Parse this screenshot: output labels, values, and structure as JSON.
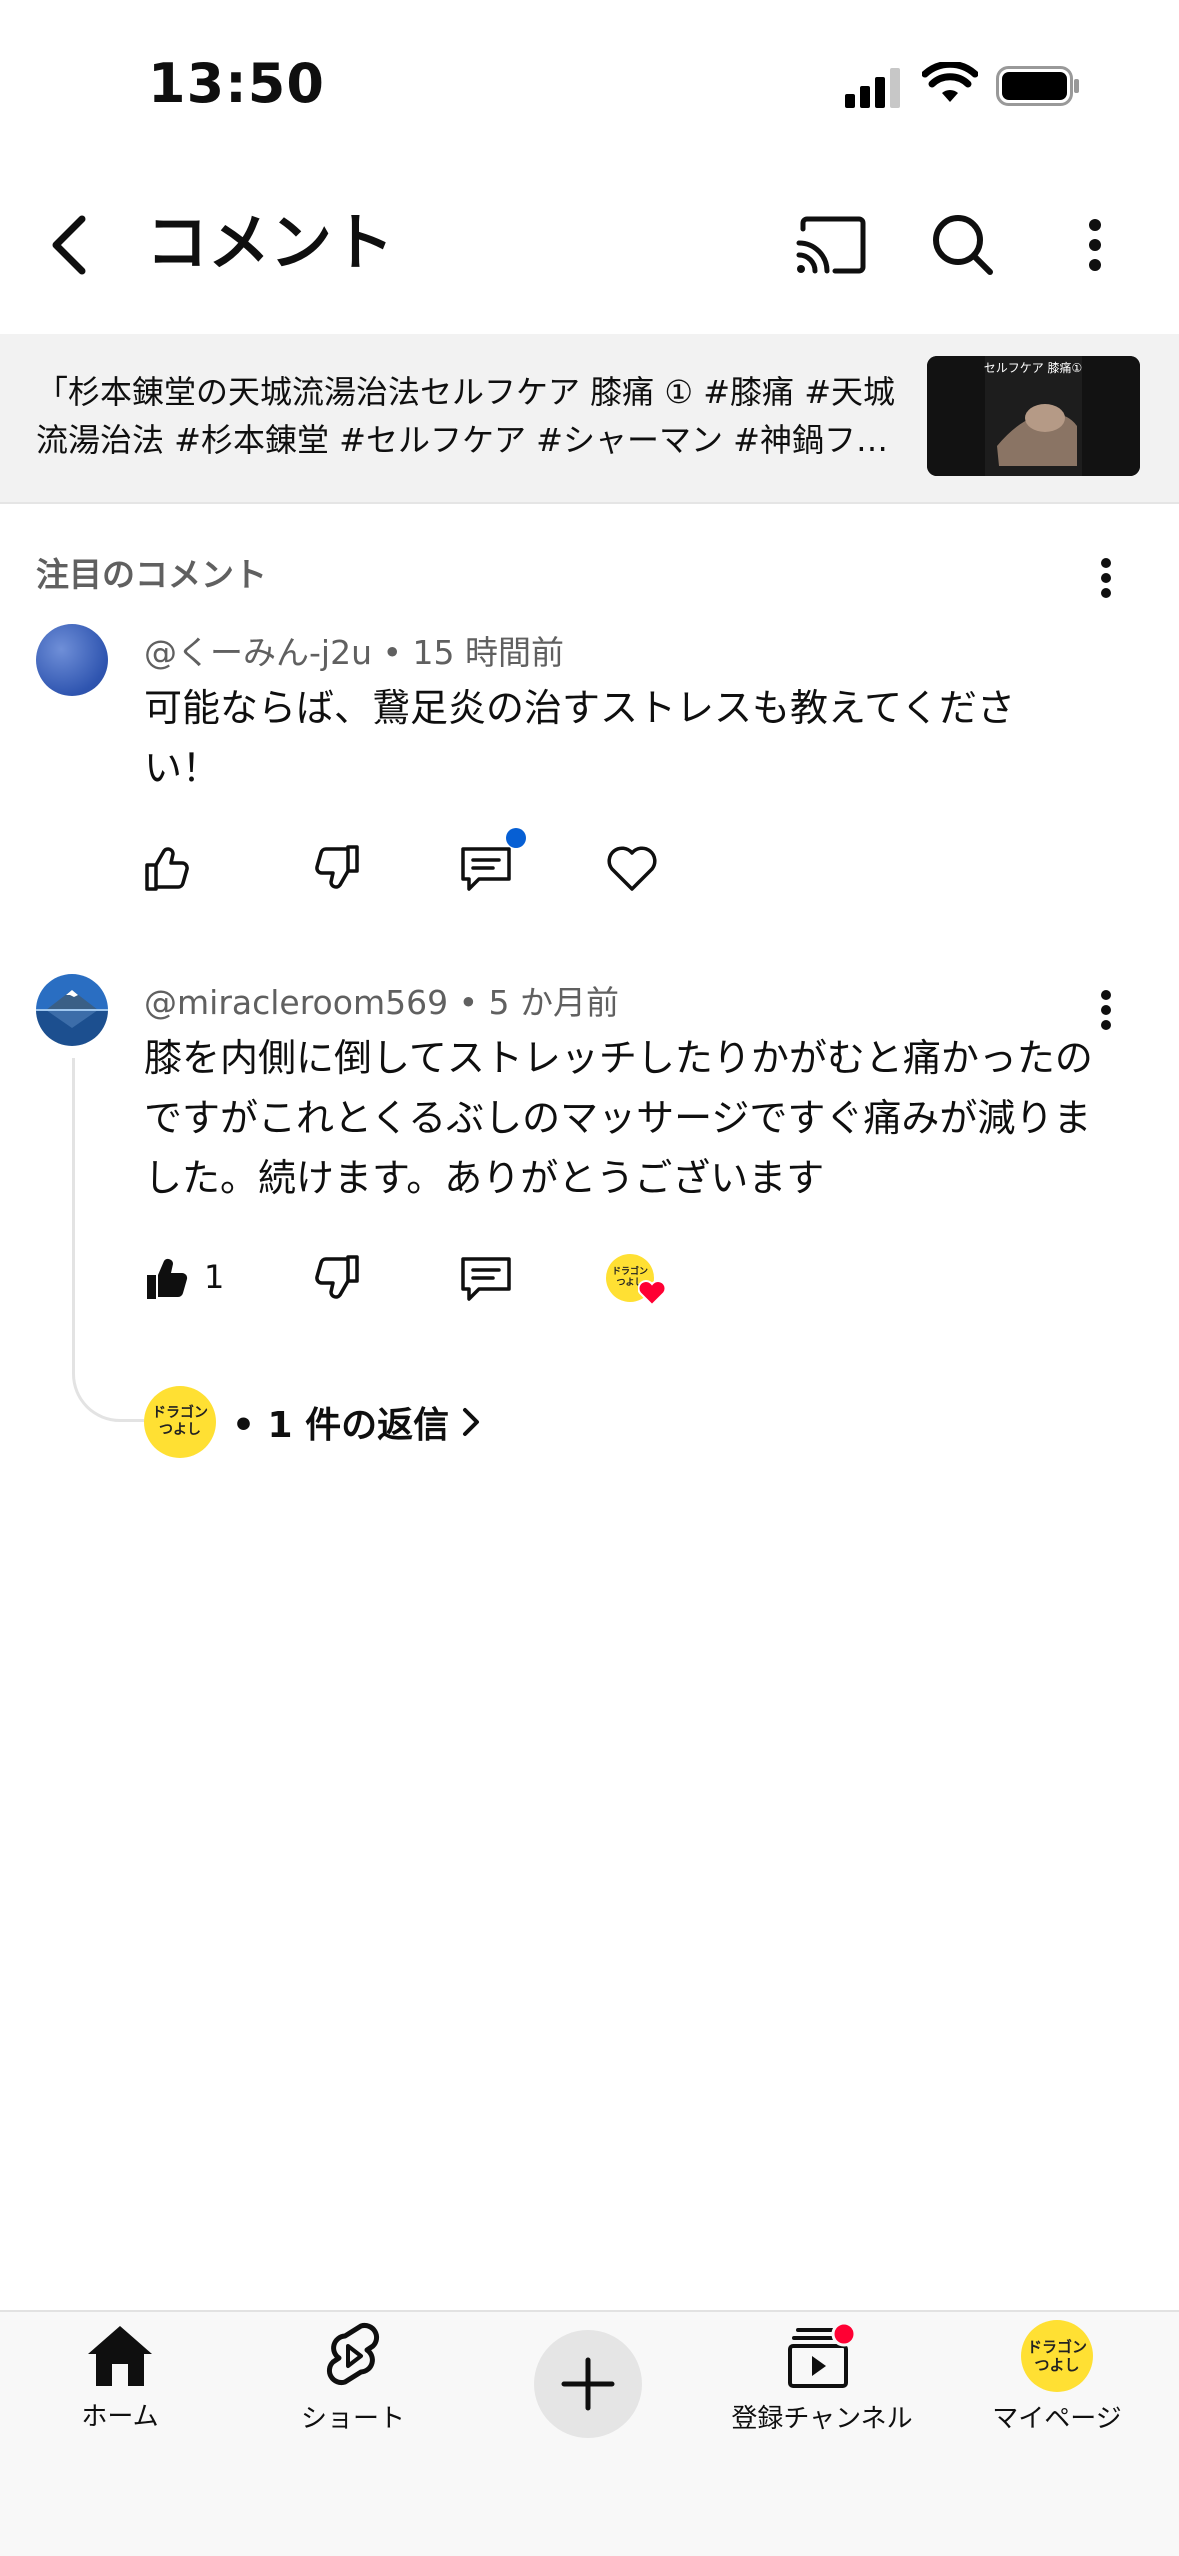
{
  "status_bar": {
    "time": "13:50"
  },
  "header": {
    "title": "コメント"
  },
  "video": {
    "title": "「杉本錬堂の天城流湯治法セルフケア 膝痛 ① #膝痛 #天城流湯治法 #杉本錬堂 #セルフケア #シャーマン #神鍋フ…",
    "thumb_caption": "セルフケア 膝痛①"
  },
  "section": {
    "title": "注目のコメント"
  },
  "comments": [
    {
      "author": "@くーみん-j2u",
      "time": "15 時間前",
      "text": "可能ならば、鵞足炎の治すストレスも教えてください！",
      "likes": ""
    },
    {
      "author": "@miracleroom569",
      "time": "5 か月前",
      "text": "膝を内側に倒してストレッチしたりかがむと痛かったのですがこれとくるぶしのマッサージですぐ痛みが減りました。続けます。ありがとうございます",
      "likes": "1",
      "replies_label": "• 1 件の返信"
    }
  ],
  "channel_badge": {
    "line1": "ドラゴン",
    "line2": "つよし"
  },
  "bottom_nav": {
    "home": "ホーム",
    "shorts": "ショート",
    "subscriptions": "登録チャンネル",
    "mypage": "マイページ"
  },
  "colors": {
    "notification_dot": "#ff0033",
    "badge_yellow": "#ffe033",
    "unread_dot": "#065fd4"
  }
}
